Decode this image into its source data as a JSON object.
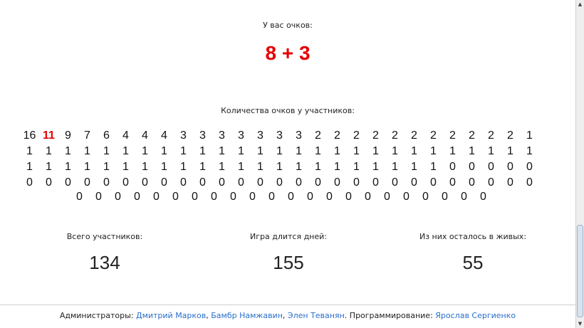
{
  "score": {
    "label": "У вас очков:",
    "value": "8 + 3"
  },
  "distribution": {
    "label": "Количества очков у участников:",
    "rows": [
      [
        "16",
        "11",
        "9",
        "7",
        "6",
        "4",
        "4",
        "4",
        "3",
        "3",
        "3",
        "3",
        "3",
        "3",
        "3",
        "2",
        "2",
        "2",
        "2",
        "2",
        "2",
        "2",
        "2",
        "2",
        "2",
        "2",
        "1"
      ],
      [
        "1",
        "1",
        "1",
        "1",
        "1",
        "1",
        "1",
        "1",
        "1",
        "1",
        "1",
        "1",
        "1",
        "1",
        "1",
        "1",
        "1",
        "1",
        "1",
        "1",
        "1",
        "1",
        "1",
        "1",
        "1",
        "1",
        "1"
      ],
      [
        "1",
        "1",
        "1",
        "1",
        "1",
        "1",
        "1",
        "1",
        "1",
        "1",
        "1",
        "1",
        "1",
        "1",
        "1",
        "1",
        "1",
        "1",
        "1",
        "1",
        "1",
        "1",
        "0",
        "0",
        "0",
        "0",
        "0"
      ],
      [
        "0",
        "0",
        "0",
        "0",
        "0",
        "0",
        "0",
        "0",
        "0",
        "0",
        "0",
        "0",
        "0",
        "0",
        "0",
        "0",
        "0",
        "0",
        "0",
        "0",
        "0",
        "0",
        "0",
        "0",
        "0",
        "0",
        "0"
      ],
      [
        "0",
        "0",
        "0",
        "0",
        "0",
        "0",
        "0",
        "0",
        "0",
        "0",
        "0",
        "0",
        "0",
        "0",
        "0",
        "0",
        "0",
        "0",
        "0",
        "0",
        "0",
        "0"
      ]
    ]
  },
  "stats": {
    "participants": {
      "label": "Всего участников:",
      "value": "134"
    },
    "days": {
      "label": "Игра длится дней:",
      "value": "155"
    },
    "alive": {
      "label": "Из них осталось в живых:",
      "value": "55"
    }
  },
  "footer": {
    "admins_label": "Администраторы:",
    "admin1": "Дмитрий Марков",
    "admin2": "Бамбр Намжавин",
    "admin3": "Элен Теванян",
    "programming_label": "Программирование:",
    "programmer": "Ярослав Сергиенко"
  },
  "colors": {
    "highlight": "#e60000",
    "link": "#2a6fc9"
  }
}
